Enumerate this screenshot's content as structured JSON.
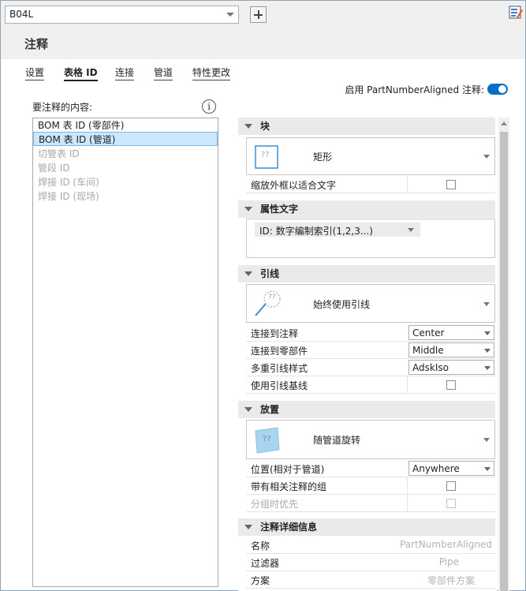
{
  "toolbar": {
    "combo_value": "B04L"
  },
  "header": {
    "title": "注释"
  },
  "tabs": [
    {
      "label": "设置"
    },
    {
      "label": "表格 ID"
    },
    {
      "label": "连接"
    },
    {
      "label": "管道"
    },
    {
      "label": "特性更改"
    }
  ],
  "toggle": {
    "label": "启用 PartNumberAligned 注释:",
    "on": true
  },
  "left": {
    "label": "要注释的内容:",
    "items": [
      {
        "label": "BOM 表 ID (零部件)"
      },
      {
        "label": "BOM 表 ID (管道)"
      },
      {
        "label": "切管表 ID"
      },
      {
        "label": "管段 ID"
      },
      {
        "label": "焊接 ID (车间)"
      },
      {
        "label": "焊接 ID (现场)"
      }
    ]
  },
  "sections": {
    "block": {
      "title": "块",
      "card_label": "矩形",
      "icon_text": "??",
      "rows": [
        {
          "label": "缩放外框以适合文字"
        }
      ]
    },
    "attr": {
      "title": "属性文字",
      "dropdown": "ID: 数字编制索引(1,2,3...)"
    },
    "leader": {
      "title": "引线",
      "card_label": "始终使用引线",
      "icon_text": "??",
      "rows": [
        {
          "label": "连接到注释",
          "value": "Center"
        },
        {
          "label": "连接到零部件",
          "value": "Middle"
        },
        {
          "label": "多重引线样式",
          "value": "AdskIso"
        },
        {
          "label": "使用引线基线"
        }
      ]
    },
    "place": {
      "title": "放置",
      "card_label": "随管道旋转",
      "icon_text": "??",
      "rows": [
        {
          "label": "位置(相对于管道)",
          "value": "Anywhere"
        },
        {
          "label": "带有相关注释的组"
        },
        {
          "label": "分组时优先"
        }
      ]
    },
    "detail": {
      "title": "注释详细信息",
      "rows": [
        {
          "label": "名称",
          "value": "PartNumberAligned"
        },
        {
          "label": "过滤器",
          "value": "Pipe"
        },
        {
          "label": "方案",
          "value": "零部件方案"
        }
      ]
    }
  },
  "colors": {
    "accent": "#0a6fc2",
    "selection": "#cce8ff"
  }
}
